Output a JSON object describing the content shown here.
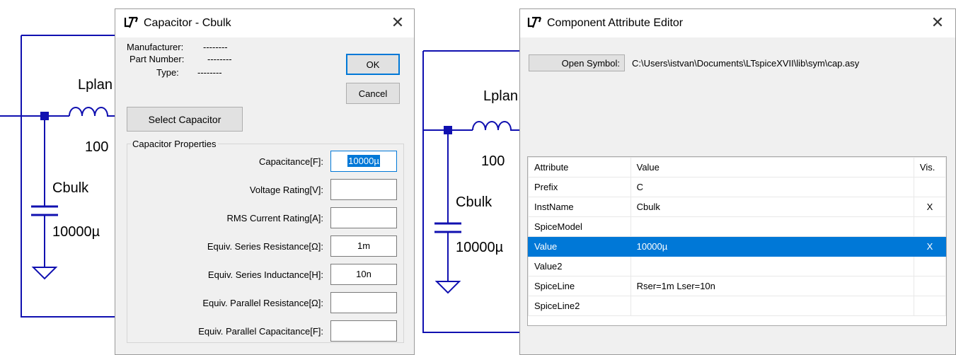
{
  "schematic_left": {
    "inductor_label": "Lplan",
    "inductor_value": "100",
    "cap_label": "Cbulk",
    "cap_value": "10000µ"
  },
  "schematic_right": {
    "inductor_label": "Lplan",
    "inductor_value": "100",
    "cap_label": "Cbulk",
    "cap_value": "10000µ"
  },
  "colors": {
    "wire": "#1010b0",
    "accent": "#0078d7"
  },
  "cap_dialog": {
    "title": "Capacitor - Cbulk",
    "manufacturer_label": "Manufacturer:",
    "manufacturer_value": "--------",
    "part_number_label": "Part Number:",
    "part_number_value": "--------",
    "type_label": "Type:",
    "type_value": "--------",
    "ok_label": "OK",
    "cancel_label": "Cancel",
    "select_label": "Select Capacitor",
    "group_title": "Capacitor Properties",
    "props": [
      {
        "label": "Capacitance[F]:",
        "value": "10000µ"
      },
      {
        "label": "Voltage Rating[V]:",
        "value": ""
      },
      {
        "label": "RMS Current Rating[A]:",
        "value": ""
      },
      {
        "label": "Equiv. Series Resistance[Ω]:",
        "value": "1m"
      },
      {
        "label": "Equiv. Series Inductance[H]:",
        "value": "10n"
      },
      {
        "label": "Equiv. Parallel Resistance[Ω]:",
        "value": ""
      },
      {
        "label": "Equiv. Parallel Capacitance[F]:",
        "value": ""
      }
    ]
  },
  "attr_dialog": {
    "title": "Component Attribute Editor",
    "open_symbol_label": "Open Symbol:",
    "symbol_path": "C:\\Users\\istvan\\Documents\\LTspiceXVII\\lib\\sym\\cap.asy",
    "headers": [
      "Attribute",
      "Value",
      "Vis."
    ],
    "rows": [
      {
        "attribute": "Prefix",
        "value": "C",
        "vis": ""
      },
      {
        "attribute": "InstName",
        "value": "Cbulk",
        "vis": "X"
      },
      {
        "attribute": "SpiceModel",
        "value": "",
        "vis": ""
      },
      {
        "attribute": "Value",
        "value": "10000µ",
        "vis": "X"
      },
      {
        "attribute": "Value2",
        "value": "",
        "vis": ""
      },
      {
        "attribute": "SpiceLine",
        "value": "Rser=1m Lser=10n",
        "vis": ""
      },
      {
        "attribute": "SpiceLine2",
        "value": "",
        "vis": ""
      }
    ],
    "selected_row": 3
  }
}
